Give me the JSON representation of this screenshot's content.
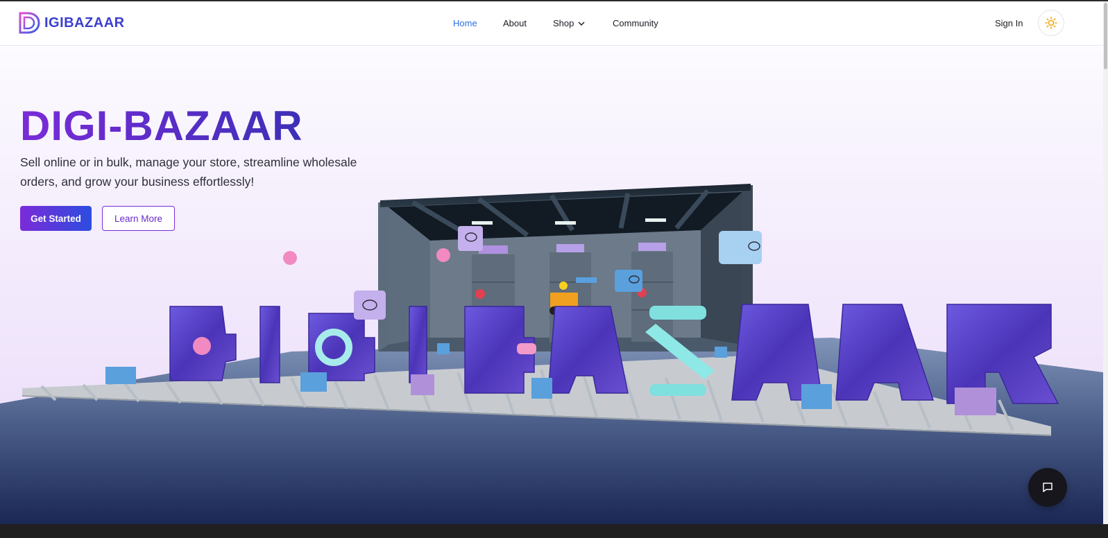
{
  "header": {
    "logo_text": "IGIBAZAAR",
    "nav": {
      "home": "Home",
      "about": "About",
      "shop": "Shop",
      "community": "Community"
    },
    "signin": "Sign In"
  },
  "hero": {
    "title": "DIGI-BAZAAR",
    "subtitle": "Sell online or in bulk, manage your store, streamline wholesale orders, and grow your business effortlessly!",
    "primary_button": "Get Started",
    "secondary_button": "Learn More"
  },
  "colors": {
    "accent_purple": "#7b2bd8",
    "accent_blue": "#2c4ddf",
    "nav_active": "#2d6fe0"
  },
  "icons": {
    "theme": "sun-icon",
    "chat": "chat-bubble-icon",
    "shop_dropdown": "chevron-down-icon"
  }
}
